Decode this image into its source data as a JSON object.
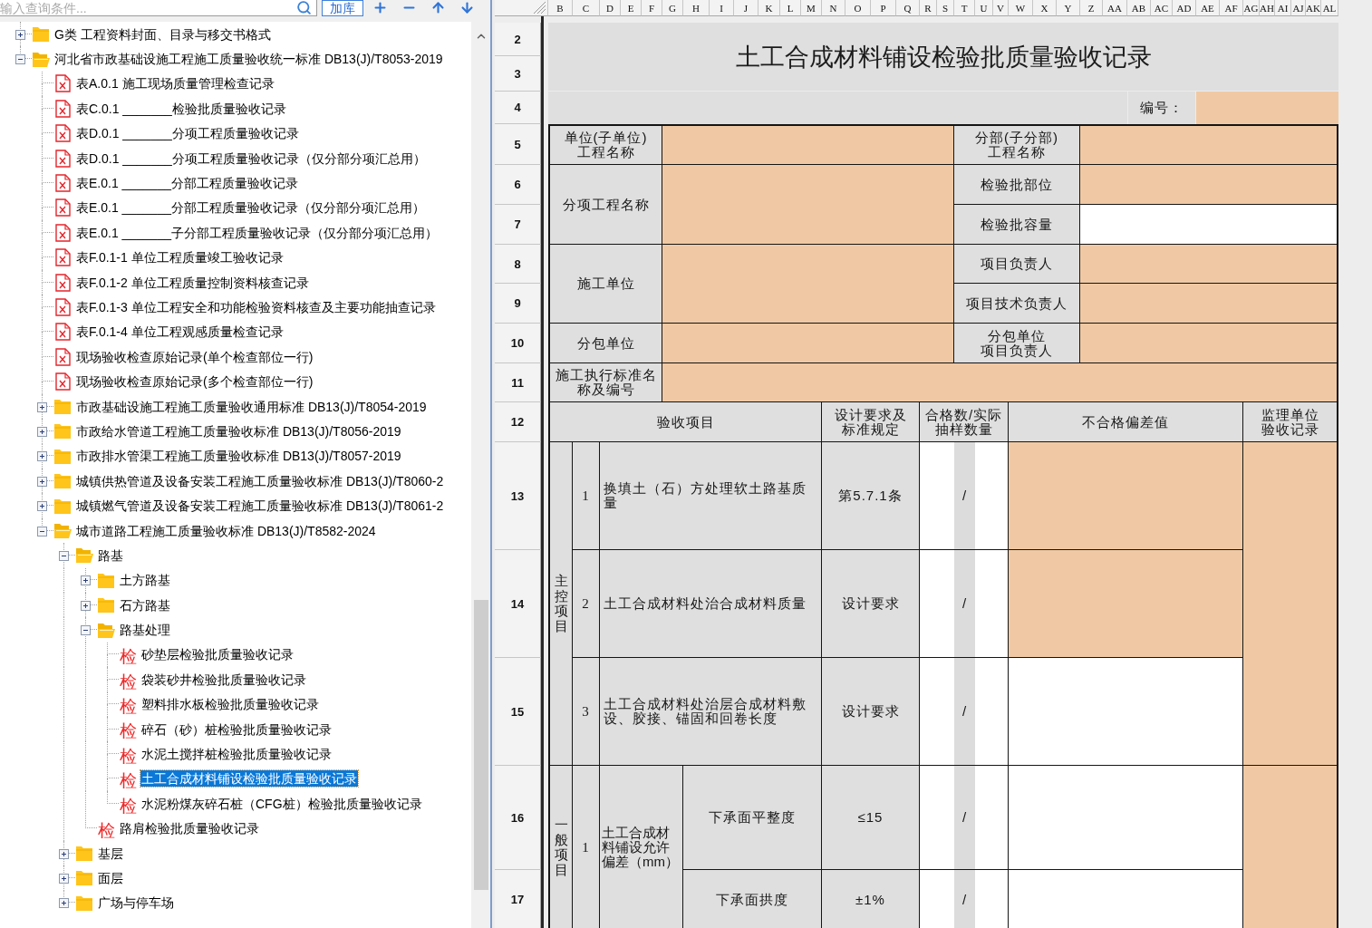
{
  "toolbar": {
    "search": {
      "placeholder": "输入查询条件..."
    },
    "add_button": "加库"
  },
  "tree": [
    {
      "label": "G类 工程资料封面、目录与移交书格式",
      "kind": "folder",
      "expanded": false,
      "selected": false
    },
    {
      "label": "河北省市政基础设施工程施工质量验收统一标准 DB13(J)/T8053-2019",
      "kind": "folder",
      "expanded": true,
      "selected": false,
      "children": [
        {
          "label": "表A.0.1 施工现场质量管理检查记录",
          "kind": "sheet",
          "selected": false
        },
        {
          "label": "表C.0.1 _______检验批质量验收记录",
          "kind": "sheet",
          "selected": false
        },
        {
          "label": "表D.0.1 _______分项工程质量验收记录",
          "kind": "sheet",
          "selected": false
        },
        {
          "label": "表D.0.1 _______分项工程质量验收记录（仅分部分项汇总用）",
          "kind": "sheet",
          "selected": false
        },
        {
          "label": "表E.0.1 _______分部工程质量验收记录",
          "kind": "sheet",
          "selected": false
        },
        {
          "label": "表E.0.1 _______分部工程质量验收记录（仅分部分项汇总用）",
          "kind": "sheet",
          "selected": false
        },
        {
          "label": "表E.0.1 _______子分部工程质量验收记录（仅分部分项汇总用）",
          "kind": "sheet",
          "selected": false
        },
        {
          "label": "表F.0.1-1 单位工程质量竣工验收记录",
          "kind": "sheet",
          "selected": false
        },
        {
          "label": "表F.0.1-2 单位工程质量控制资料核查记录",
          "kind": "sheet",
          "selected": false
        },
        {
          "label": "表F.0.1-3 单位工程安全和功能检验资料核查及主要功能抽查记录",
          "kind": "sheet",
          "selected": false
        },
        {
          "label": "表F.0.1-4 单位工程观感质量检查记录",
          "kind": "sheet",
          "selected": false
        },
        {
          "label": "现场验收检查原始记录(单个检查部位一行)",
          "kind": "sheet",
          "selected": false
        },
        {
          "label": "现场验收检查原始记录(多个检查部位一行)",
          "kind": "sheet",
          "selected": false
        },
        {
          "label": "市政基础设施工程施工质量验收通用标准 DB13(J)/T8054-2019",
          "kind": "folder",
          "expanded": false,
          "selected": false
        },
        {
          "label": "市政给水管道工程施工质量验收标准 DB13(J)/T8056-2019",
          "kind": "folder",
          "expanded": false,
          "selected": false
        },
        {
          "label": "市政排水管渠工程施工质量验收标准 DB13(J)/T8057-2019",
          "kind": "folder",
          "expanded": false,
          "selected": false
        },
        {
          "label": "城镇供热管道及设备安装工程施工质量验收标准 DB13(J)/T8060-2",
          "kind": "folder",
          "expanded": false,
          "selected": false
        },
        {
          "label": "城镇燃气管道及设备安装工程施工质量验收标准 DB13(J)/T8061-2",
          "kind": "folder",
          "expanded": false,
          "selected": false
        },
        {
          "label": "城市道路工程施工质量验收标准 DB13(J)/T8582-2024",
          "kind": "folder",
          "expanded": true,
          "selected": false,
          "children": [
            {
              "label": "路基",
              "kind": "folder",
              "expanded": true,
              "selected": false,
              "children": [
                {
                  "label": "土方路基",
                  "kind": "folder",
                  "expanded": false,
                  "selected": false
                },
                {
                  "label": "石方路基",
                  "kind": "folder",
                  "expanded": false,
                  "selected": false
                },
                {
                  "label": "路基处理",
                  "kind": "folder",
                  "expanded": true,
                  "selected": false,
                  "children": [
                    {
                      "label": "砂垫层检验批质量验收记录",
                      "kind": "record",
                      "mark": "检",
                      "selected": false
                    },
                    {
                      "label": "袋装砂井检验批质量验收记录",
                      "kind": "record",
                      "mark": "检",
                      "selected": false
                    },
                    {
                      "label": "塑料排水板检验批质量验收记录",
                      "kind": "record",
                      "mark": "检",
                      "selected": false
                    },
                    {
                      "label": "碎石（砂）桩检验批质量验收记录",
                      "kind": "record",
                      "mark": "检",
                      "selected": false
                    },
                    {
                      "label": "水泥土搅拌桩检验批质量验收记录",
                      "kind": "record",
                      "mark": "检",
                      "selected": false
                    },
                    {
                      "label": "土工合成材料铺设检验批质量验收记录",
                      "kind": "record",
                      "mark": "检",
                      "selected": true
                    },
                    {
                      "label": "水泥粉煤灰碎石桩（CFG桩）检验批质量验收记录",
                      "kind": "record",
                      "mark": "检",
                      "selected": false
                    }
                  ]
                },
                {
                  "label": "路肩检验批质量验收记录",
                  "kind": "record",
                  "mark": "检",
                  "selected": false
                }
              ]
            },
            {
              "label": "基层",
              "kind": "folder",
              "expanded": false,
              "selected": false
            },
            {
              "label": "面层",
              "kind": "folder",
              "expanded": false,
              "selected": false
            },
            {
              "label": "广场与停车场",
              "kind": "folder",
              "expanded": false,
              "selected": false
            }
          ]
        }
      ]
    }
  ],
  "sheet": {
    "column_headers": [
      "B",
      "C",
      "D",
      "E",
      "F",
      "G",
      "H",
      "I",
      "J",
      "K",
      "L",
      "M",
      "N",
      "O",
      "P",
      "Q",
      "R",
      "S",
      "T",
      "U",
      "V",
      "W",
      "X",
      "Y",
      "Z",
      "AA",
      "AB",
      "AC",
      "AD",
      "AE",
      "AF",
      "AG",
      "AH",
      "AI",
      "AJ",
      "AK",
      "AL"
    ],
    "row_headers": [
      "2",
      "3",
      "4",
      "5",
      "6",
      "7",
      "8",
      "9",
      "10",
      "11",
      "12",
      "13",
      "14",
      "15",
      "16",
      "17"
    ],
    "title": "土工合成材料铺设检验批质量验收记录",
    "number": {
      "label": "编号：",
      "highlighted": true
    },
    "fields": [
      {
        "lines": [
          "单位(子单位)",
          "工程名称"
        ],
        "highlighted": true
      },
      {
        "lines": [
          "分部(子分部)",
          "工程名称"
        ],
        "highlighted": true
      },
      {
        "lines": [
          "检验批部位"
        ],
        "highlighted": true
      },
      {
        "lines": [
          "分项工程名称"
        ],
        "highlighted": true
      },
      {
        "lines": [
          "检验批容量"
        ],
        "highlighted": false
      },
      {
        "lines": [
          "项目负责人"
        ],
        "highlighted": true
      },
      {
        "lines": [
          "施工单位"
        ],
        "highlighted": true
      },
      {
        "lines": [
          "项目技术负责人"
        ],
        "highlighted": true
      },
      {
        "lines": [
          "分包单位"
        ],
        "highlighted": true
      },
      {
        "lines": [
          "分包单位",
          "项目负责人"
        ],
        "highlighted": true
      },
      {
        "lines": [
          "施工执行标准名称及编号"
        ],
        "highlighted": true
      }
    ],
    "header": [
      {
        "lines": [
          "验收项目"
        ]
      },
      {
        "lines": [
          "设计要求及",
          "标准规定"
        ]
      },
      {
        "lines": [
          "合格数/实际",
          "抽样数量"
        ]
      },
      {
        "lines": [
          "不合格偏差值"
        ]
      },
      {
        "lines": [
          "监理单位",
          "验收记录"
        ]
      }
    ],
    "groups": [
      {
        "name": "主控项目",
        "review_highlighted": true,
        "items": [
          {
            "kind": "single",
            "no": "1",
            "item": "换填土（石）方处理软土路基质量",
            "requirement": "第5.7.1条",
            "count": "/",
            "deviation_highlighted": true
          },
          {
            "kind": "single",
            "no": "2",
            "item": "土工合成材料处治合成材料质量",
            "requirement": "设计要求",
            "count": "/",
            "deviation_highlighted": true
          },
          {
            "kind": "single",
            "no": "3",
            "item": "土工合成材料处治层合成材料敷设、胶接、锚固和回卷长度",
            "requirement": "设计要求",
            "count": "/",
            "deviation_highlighted": false
          }
        ]
      },
      {
        "name": "一般项目",
        "review_highlighted": true,
        "items": [
          {
            "kind": "tolerance",
            "no": "1",
            "item": "土工合成材料铺设允许偏差（mm）",
            "checks": [
              {
                "item": "下承面平整度",
                "requirement": "≤15",
                "count": "/",
                "deviation_highlighted": false
              },
              {
                "item": "下承面拱度",
                "requirement": "±1%",
                "count": "/",
                "deviation_highlighted": false
              }
            ]
          }
        ]
      }
    ]
  }
}
